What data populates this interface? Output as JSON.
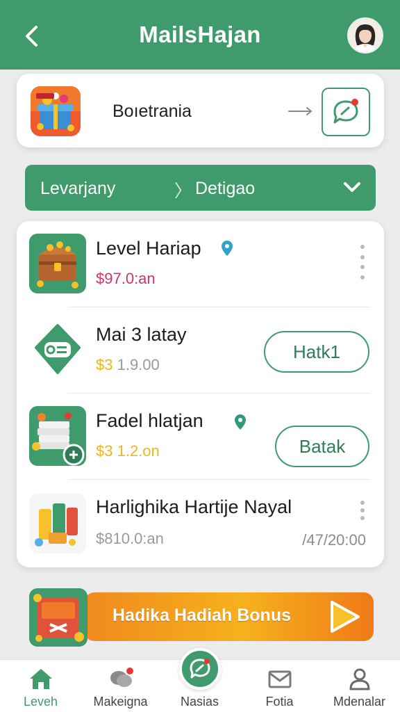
{
  "header": {
    "title": "MailsHajan"
  },
  "top_card": {
    "label": "Boıetrania"
  },
  "dropdown": {
    "left_label": "Levarjany",
    "separator": "〉",
    "right_label": "Detigao"
  },
  "list": {
    "items": [
      {
        "title": "Level Hariap",
        "price_prefix": "$",
        "price": "97.0:an",
        "price_color": "#d0336b",
        "action": "",
        "right_text": ""
      },
      {
        "title": "Mai 3 latay",
        "price_prefix": "$3",
        "price": " 1.9.00",
        "price_color": "#f0b41c",
        "action": "Hatk1",
        "right_text": ""
      },
      {
        "title": "Fadel hlatjan",
        "price_prefix": "$3",
        "price": " 1.2.on",
        "price_color": "#f0b41c",
        "action": "Batak",
        "right_text": ""
      },
      {
        "title": "Harlighika Hartije Nayal",
        "price_prefix": "$",
        "price": "810.0:an",
        "price_color": "#9a9a9a",
        "action": "",
        "right_text": "/47/20:00"
      }
    ]
  },
  "bonus": {
    "label": "Hadika Hadiah Bonus"
  },
  "bottom_nav": {
    "items": [
      {
        "label": "Leveh",
        "icon": "home-icon"
      },
      {
        "label": "Makeigna",
        "icon": "chat-icon"
      },
      {
        "label": "Nasias",
        "icon": "center-chat-icon"
      },
      {
        "label": "Fotia",
        "icon": "mail-icon"
      },
      {
        "label": "Mdenalar",
        "icon": "person-icon"
      }
    ]
  },
  "colors": {
    "primary": "#3f9a6c",
    "accent_pink": "#d0336b",
    "accent_gold": "#f0b41c",
    "bonus_orange": "#f08a1e"
  }
}
